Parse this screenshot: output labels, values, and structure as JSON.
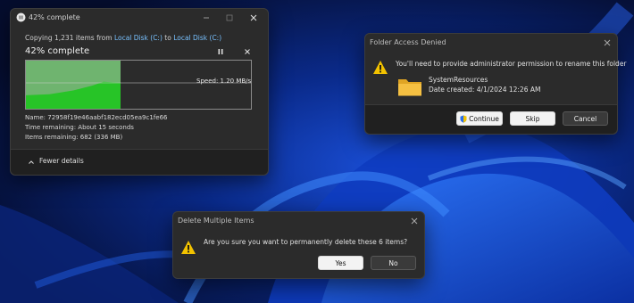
{
  "copy_dialog": {
    "title": "42% complete",
    "copying_prefix": "Copying 1,231 items from",
    "source": "Local Disk (C:)",
    "to_word": "to",
    "destination": "Local Disk (C:)",
    "percent_label": "42% complete",
    "progress": 0.42,
    "speed": "Speed: 1.20 MB/s",
    "name_line": "Name: 72958f19e46aabf182ecd05ea9c1fe66",
    "time_remaining": "Time remaining: About 15 seconds",
    "items_remaining": "Items remaining: 682 (336 MB)",
    "fewer_details": "Fewer details"
  },
  "folder_dialog": {
    "title": "Folder Access Denied",
    "message": "You'll need to provide administrator permission to rename this folder",
    "folder_name": "SystemResources",
    "date_created": "Date created: 4/1/2024 12:26 AM",
    "continue_label": "Continue",
    "skip_label": "Skip",
    "cancel_label": "Cancel"
  },
  "delete_dialog": {
    "title": "Delete Multiple Items",
    "message": "Are you sure you want to permanently delete these 6 items?",
    "yes_label": "Yes",
    "no_label": "No"
  },
  "colors": {
    "progress_fill": "#27c427",
    "progress_track": "#6fb46f",
    "warning": "#f2c200",
    "link": "#78c1ff",
    "folder": "#f5c042"
  }
}
